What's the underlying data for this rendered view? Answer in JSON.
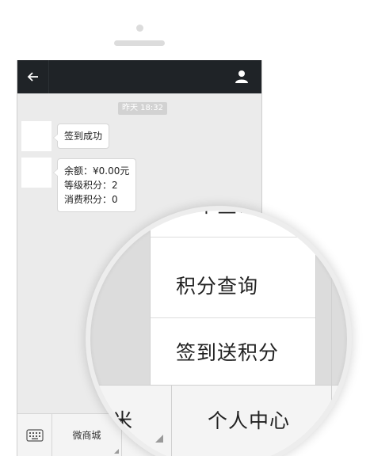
{
  "header": {
    "back_icon": "arrow-left-icon",
    "profile_icon": "user-icon"
  },
  "chat": {
    "timestamp": "昨天 18:32",
    "messages": [
      {
        "lines": [
          "签到成功"
        ]
      },
      {
        "lines": [
          "余额：¥0.00元",
          "等级积分：2",
          "消费积分：0"
        ]
      }
    ]
  },
  "bottom_menu": {
    "keyboard_icon": "keyboard-icon",
    "tabs": [
      {
        "label": "微商城"
      },
      {
        "label": ""
      }
    ]
  },
  "magnified_menu": {
    "items": [
      {
        "label": "订单查询"
      },
      {
        "label": "积分查询"
      },
      {
        "label": "签到送积分"
      }
    ],
    "tab_left_partial": "米",
    "tab_right": "个人中心"
  },
  "colors": {
    "topbar": "#1f2327",
    "chat_bg": "#ebebeb",
    "bubble_bg": "#ffffff",
    "timestamp_bg": "#d2d2d2"
  }
}
